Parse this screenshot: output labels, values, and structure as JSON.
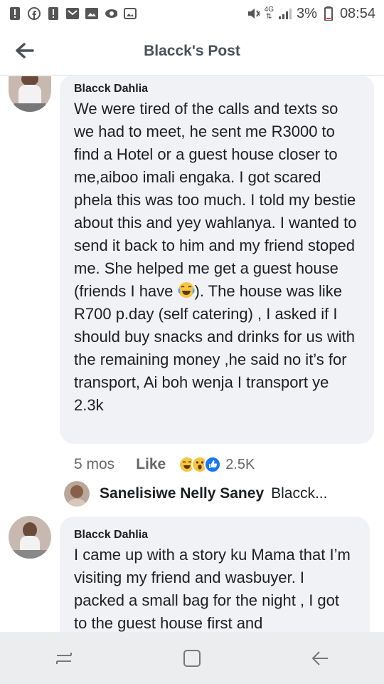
{
  "status_bar": {
    "network": "4G",
    "battery": "3%",
    "time": "08:54"
  },
  "header": {
    "title": "Blacck's Post"
  },
  "comments": [
    {
      "author": "Blacck Dahlia",
      "text_before_emoji": "We were tired of the calls and texts so we had to meet, he sent me R3000 to find a Hotel or a guest house closer to me,aiboo imali engaka. I got scared phela this was too much. I told my bestie about this and yey wahlanya. I wanted to send it back to him and my friend stoped me. She helped me get a guest house (friends I have ",
      "emoji": "crying-laughing-emoji",
      "text_after_emoji": "). The house was like R700 p.day (self catering) , I asked if I should buy snacks and drinks for us with the remaining money ,he said no it’s for transport, Ai boh wenja I transport ye 2.3k",
      "time": "5 mos",
      "like_label": "Like",
      "reactions": [
        "haha",
        "wow",
        "like"
      ],
      "reaction_count": "2.5K",
      "reply_preview": {
        "name": "Sanelisiwe Nelly Saney",
        "snippet": "Blacck..."
      }
    },
    {
      "author": "Blacck Dahlia",
      "text": "I came up with a story ku Mama that I’m visiting my friend and wasbuyer. I packed a small bag for the night , I got to the guest house first and"
    }
  ],
  "colors": {
    "bubble_bg": "#f0f2f5",
    "meta_text": "#65676b",
    "like_blue": "#1877f2",
    "haha_yellow": "#f7c544"
  }
}
